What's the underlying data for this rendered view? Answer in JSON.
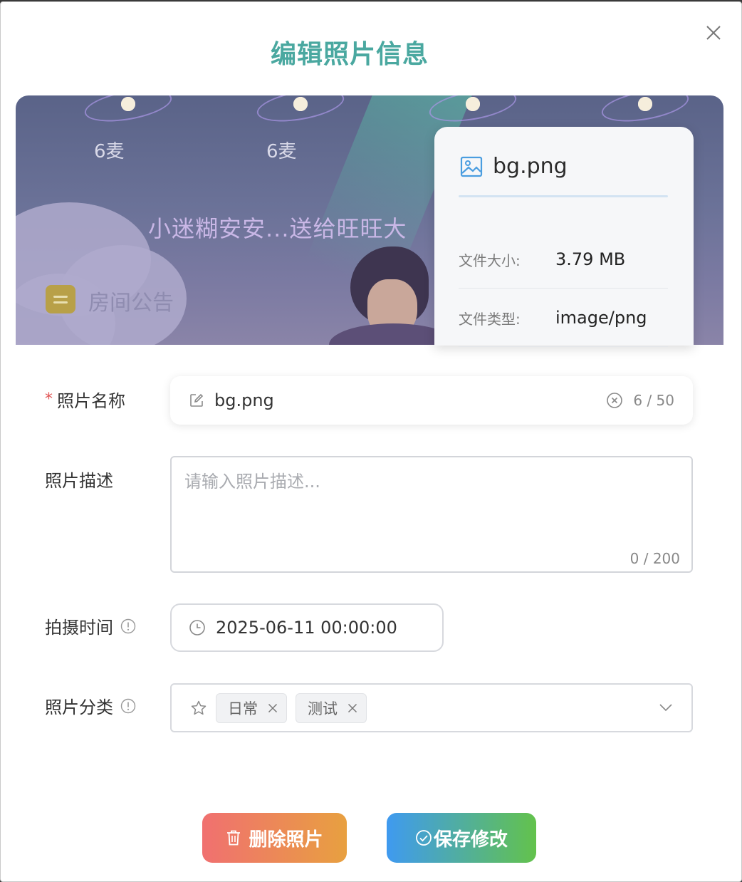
{
  "dialog": {
    "title": "编辑照片信息",
    "close_icon": "close-icon"
  },
  "preview": {
    "mic_labels": [
      "6麦",
      "6麦"
    ],
    "gift_text": "小迷糊安安...送给旺旺大",
    "notice_text": "房间公告"
  },
  "file_info": {
    "file_name": "bg.png",
    "icon": "image-icon",
    "size_label": "文件大小:",
    "size_value": "3.79 MB",
    "type_label": "文件类型:",
    "type_value": "image/png",
    "accent_color": "#4a9de0"
  },
  "form": {
    "name": {
      "label": "照片名称",
      "required_mark": "*",
      "value": "bg.png",
      "count": "6 / 50"
    },
    "description": {
      "label": "照片描述",
      "placeholder": "请输入照片描述...",
      "count": "0 / 200"
    },
    "time": {
      "label": "拍摄时间",
      "value": "2025-06-11 00:00:00"
    },
    "category": {
      "label": "照片分类",
      "tags": [
        "日常",
        "测试"
      ]
    }
  },
  "actions": {
    "delete_label": "删除照片",
    "save_label": "保存修改"
  },
  "colors": {
    "title": "#4aa8a0",
    "delete_gradient": [
      "#f07070",
      "#e8a040"
    ],
    "save_gradient": [
      "#3f9af0",
      "#63c24c"
    ],
    "required": "#e05454"
  }
}
